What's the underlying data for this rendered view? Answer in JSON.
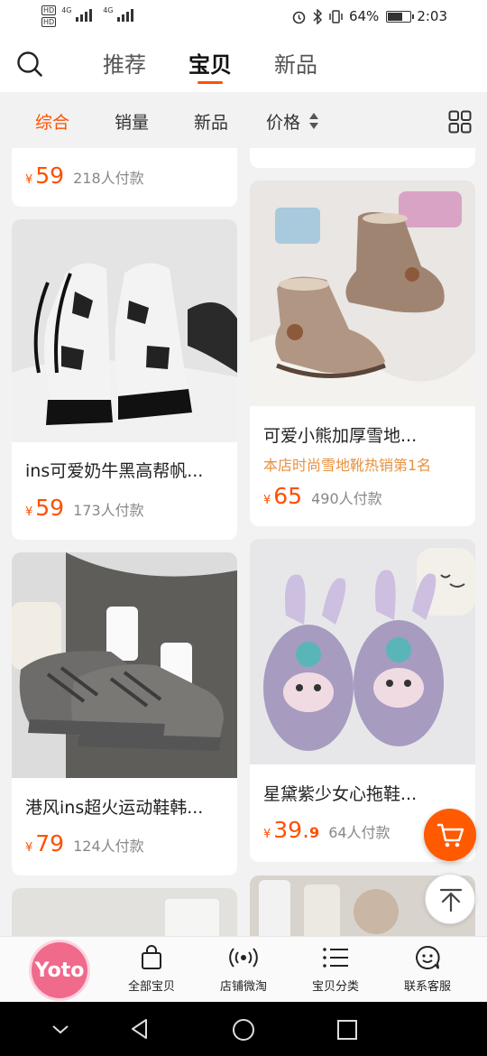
{
  "status_bar": {
    "hd1": "HD",
    "hd2": "HD",
    "net1": "4G",
    "net2": "4G",
    "battery_percent": "64%",
    "time": "2:03"
  },
  "nav": {
    "tabs": [
      {
        "label": "推荐",
        "active": false
      },
      {
        "label": "宝贝",
        "active": true
      },
      {
        "label": "新品",
        "active": false
      }
    ]
  },
  "sort_bar": {
    "items": [
      {
        "label": "综合",
        "active": true
      },
      {
        "label": "销量",
        "active": false
      },
      {
        "label": "新品",
        "active": false
      },
      {
        "label": "价格",
        "active": false
      }
    ]
  },
  "products": [
    {
      "currency": "¥",
      "price": "59",
      "price_dec": "",
      "sold": "218人付款"
    },
    {
      "title": "可爱小熊加厚雪地...",
      "promo": "本店时尚雪地靴热销第1名",
      "currency": "¥",
      "price": "65",
      "price_dec": "",
      "sold": "490人付款"
    },
    {
      "title": "ins可爱奶牛黑高帮帆...",
      "currency": "¥",
      "price": "59",
      "price_dec": "",
      "sold": "173人付款"
    },
    {
      "title": "星黛紫少女心拖鞋...",
      "currency": "¥",
      "price": "39.",
      "price_dec": "9",
      "sold": "64人付款"
    },
    {
      "title": "港风ins超火运动鞋韩...",
      "currency": "¥",
      "price": "79",
      "price_dec": "",
      "sold": "124人付款"
    }
  ],
  "bottom_bar": {
    "logo_text": "Yoto",
    "items": [
      {
        "label": "全部宝贝",
        "icon": "shopping-bag-icon"
      },
      {
        "label": "店铺微淘",
        "icon": "broadcast-icon"
      },
      {
        "label": "宝贝分类",
        "icon": "list-icon"
      },
      {
        "label": "联系客服",
        "icon": "smiley-chat-icon"
      }
    ]
  },
  "colors": {
    "accent": "#ff5000",
    "promo": "#e8913f",
    "logo_bg": "#f06a8c"
  }
}
